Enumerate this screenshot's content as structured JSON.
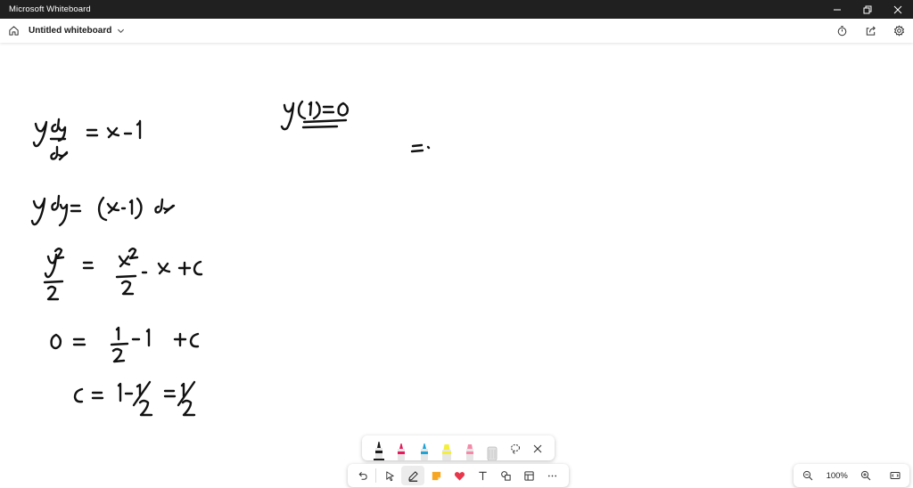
{
  "window": {
    "title": "Microsoft Whiteboard"
  },
  "header": {
    "board_title": "Untitled whiteboard"
  },
  "zoom": {
    "level": "100%"
  },
  "icons": {
    "home": "home-icon",
    "chevron": "chevron-down-icon",
    "timer": "timer-icon",
    "share": "share-icon",
    "settings": "gear-icon",
    "undo": "undo-icon",
    "select": "cursor-icon",
    "pen": "pen-icon",
    "sticky_note": "sticky-note-icon",
    "reactions": "heart-icon",
    "text": "text-icon",
    "shapes": "shapes-icon",
    "templates": "template-icon",
    "more": "more-icon",
    "lasso": "lasso-icon",
    "close": "close-icon",
    "zoom_out": "zoom-out-icon",
    "zoom_in": "zoom-in-icon",
    "fit": "fit-screen-icon"
  },
  "colors": {
    "titlebar": "#202020",
    "ink": "#111111",
    "pen_black": "#1a1a1a",
    "pen_red": "#e8195a",
    "pen_blue": "#1fa3d6",
    "highlighter_yellow": "#f3ef3a",
    "pen_pink": "#f48aa8",
    "eraser": "#cfcfcf",
    "reaction_red": "#e8364a",
    "sticky_orange": "#f6a623"
  },
  "pens": [
    {
      "name": "black-pen",
      "color": "#1a1a1a",
      "selected": true
    },
    {
      "name": "red-pen",
      "color": "#e8195a",
      "selected": false
    },
    {
      "name": "blue-pen",
      "color": "#1fa3d6",
      "selected": false
    },
    {
      "name": "yellow-highlighter",
      "color": "#f3ef3a",
      "selected": false
    },
    {
      "name": "pink-pen",
      "color": "#f48aa8",
      "selected": false
    }
  ]
}
